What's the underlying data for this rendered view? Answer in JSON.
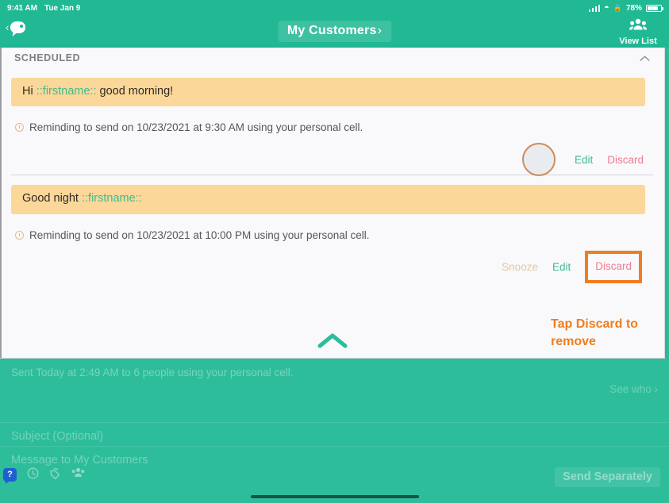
{
  "status_bar": {
    "time": "9:41 AM",
    "date": "Tue Jan 9",
    "battery": "78%",
    "icons": [
      "signal-icon",
      "wifi-icon",
      "lock-icon",
      "battery-icon"
    ]
  },
  "header": {
    "back_chevron": "‹",
    "back_icon": "chat-bubble-icon",
    "title": "My Customers",
    "title_chevron": "›",
    "right_action_icon": "people-group-icon",
    "right_action_label": "View List"
  },
  "scheduled_panel": {
    "section_title": "SCHEDULED",
    "collapse_icon": "chevron-up-icon",
    "expand_icon": "chevron-up-icon",
    "items": [
      {
        "message_prefix": "Hi ",
        "message_token": "::firstname::",
        "message_suffix": " good morning!",
        "reminder": "Reminding to send on 10/23/2021 at 9:30 AM using your personal cell.",
        "reminder_icon": "clock-icon",
        "actions": [
          "Edit",
          "Discard"
        ],
        "has_tap_circle": true
      },
      {
        "message_prefix": "Good night ",
        "message_token": "::firstname::",
        "message_suffix": "",
        "reminder": "Reminding to send on 10/23/2021 at 10:00 PM using your personal cell.",
        "reminder_icon": "clock-icon",
        "actions": [
          "Snooze",
          "Edit",
          "Discard"
        ],
        "has_tap_circle": false
      }
    ]
  },
  "annotation": {
    "line1": "Tap Discard to",
    "line2": "remove",
    "color": "#f07d1e"
  },
  "background": {
    "sent_status": "Sent Today at 2:49 AM to 6 people using your personal cell.",
    "see_who": "See who ›",
    "subject_placeholder": "Subject (Optional)",
    "message_placeholder": "Message to My Customers",
    "toolbar_icons": [
      "help-icon",
      "clock-icon",
      "tag-icon",
      "people-icon"
    ],
    "help_label": "?",
    "send_button": "Send Separately"
  },
  "colors": {
    "brand_teal": "#2ebd9b",
    "nav_teal": "#21b894",
    "bubble_amber": "#fbd79a",
    "token_green": "#3fbb8e",
    "discard_pink": "#ef7d8f",
    "highlight_orange": "#f07d1e"
  }
}
